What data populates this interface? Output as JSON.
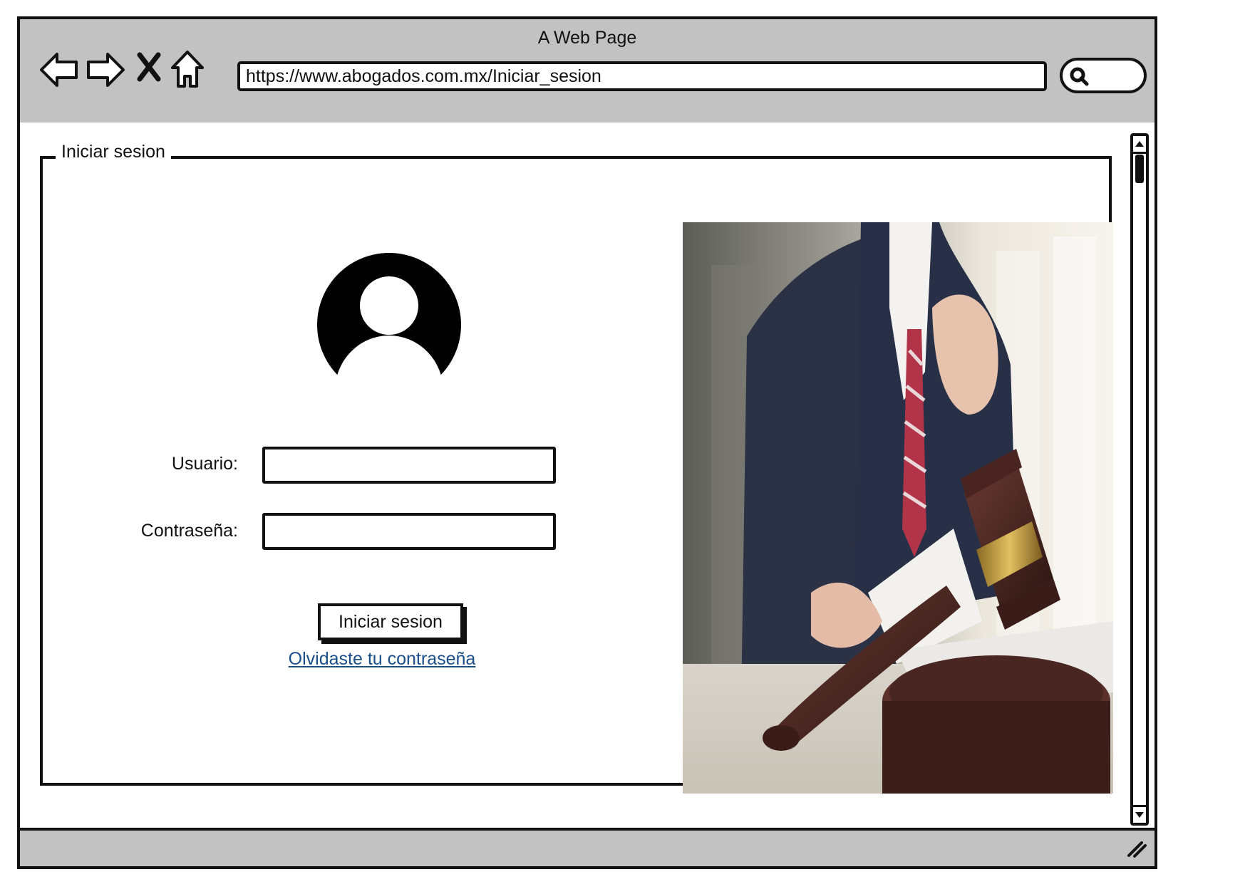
{
  "window": {
    "title": "A Web Page",
    "url": "https://www.abogados.com.mx/Iniciar_sesion"
  },
  "nav_icons": [
    "back-arrow-icon",
    "forward-arrow-icon",
    "stop-icon",
    "home-icon",
    "search-icon"
  ],
  "login": {
    "legend": "Iniciar sesion",
    "username_label": "Usuario:",
    "username_value": "",
    "password_label": "Contraseña:",
    "password_value": "",
    "submit_label": "Iniciar sesion",
    "forgot_link": "Olvidaste tu contraseña"
  },
  "colors": {
    "chrome": "#c2c2c2",
    "link": "#1a4f8a",
    "outline": "#111111"
  }
}
